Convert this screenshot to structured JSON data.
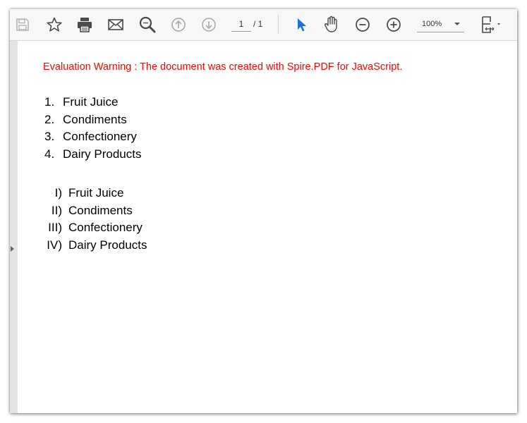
{
  "toolbar": {
    "page_current": "1",
    "page_total": "/ 1",
    "zoom": "100%",
    "icons": [
      "save-icon",
      "bookmark-star-icon",
      "print-icon",
      "email-icon",
      "search-icon",
      "previous-page-icon",
      "next-page-icon",
      "select-pointer-icon",
      "hand-tool-icon",
      "zoom-out-icon",
      "zoom-in-icon",
      "page-fit-icon"
    ],
    "accent_color": "#1e6fd9"
  },
  "document": {
    "warning": "Evaluation Warning : The document was created with Spire.PDF for JavaScript.",
    "warning_color": "#ff0000",
    "numbered_list": [
      {
        "marker": "1.",
        "text": "Fruit Juice"
      },
      {
        "marker": "2.",
        "text": "Condiments"
      },
      {
        "marker": "3.",
        "text": "Confectionery"
      },
      {
        "marker": "4.",
        "text": "Dairy Products"
      }
    ],
    "roman_list": [
      {
        "marker": "I)",
        "text": "Fruit Juice"
      },
      {
        "marker": "II)",
        "text": "Condiments"
      },
      {
        "marker": "III)",
        "text": "Confectionery"
      },
      {
        "marker": "IV)",
        "text": "Dairy Products"
      }
    ]
  }
}
